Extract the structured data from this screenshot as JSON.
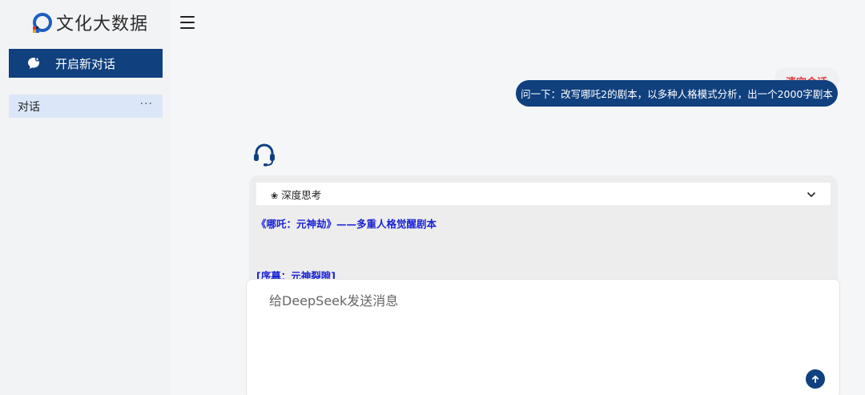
{
  "app": {
    "brand": "文化大数据"
  },
  "sidebar": {
    "new_chat_label": "开启新对话",
    "conversations": [
      {
        "label": "对话",
        "more": "···"
      }
    ]
  },
  "header": {
    "clear_label": "清空会话"
  },
  "chat": {
    "user_message": "问一下：改写哪吒2的剧本，以多种人格模式分析，出一个2000字剧本",
    "think_label": "深度思考",
    "answer_title": "《哪吒：元神劫》——多重人格觉醒剧本",
    "answer_section": "[序幕：元神裂隙]"
  },
  "composer": {
    "placeholder": "给DeepSeek发送消息"
  },
  "colors": {
    "primary": "#10407e",
    "accent_red": "#e4393c",
    "answer_blue": "#1a23d4"
  },
  "icons": {
    "logo": "logo-mark-icon",
    "new_chat": "chat-bubble-icon",
    "menu": "hamburger-icon",
    "assistant": "headset-icon",
    "think": "flower-icon",
    "expand": "chevron-down-icon",
    "send": "arrow-up-icon"
  }
}
